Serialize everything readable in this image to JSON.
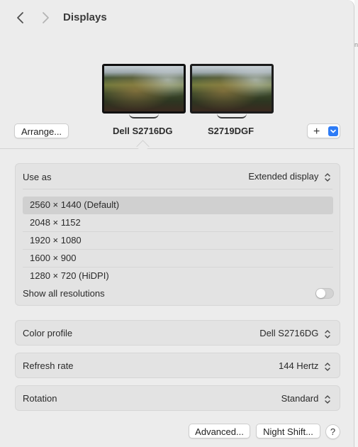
{
  "window": {
    "title": "Displays"
  },
  "displays": [
    {
      "name": "Dell S2716DG",
      "selected": true
    },
    {
      "name": "S2719DGF",
      "selected": false
    }
  ],
  "toolbar": {
    "arrange_label": "Arrange...",
    "add_label": "+"
  },
  "use_as": {
    "label": "Use as",
    "value": "Extended display"
  },
  "resolutions": [
    {
      "label": "2560 × 1440 (Default)",
      "selected": true
    },
    {
      "label": "2048 × 1152",
      "selected": false
    },
    {
      "label": "1920 × 1080",
      "selected": false
    },
    {
      "label": "1600 × 900",
      "selected": false
    },
    {
      "label": "1280 × 720 (HiDPI)",
      "selected": false
    }
  ],
  "show_all": {
    "label": "Show all resolutions",
    "enabled": false
  },
  "color_profile": {
    "label": "Color profile",
    "value": "Dell S2716DG"
  },
  "refresh_rate": {
    "label": "Refresh rate",
    "value": "144 Hertz"
  },
  "rotation": {
    "label": "Rotation",
    "value": "Standard"
  },
  "footer": {
    "advanced_label": "Advanced...",
    "night_shift_label": "Night Shift...",
    "help_label": "?"
  },
  "colors": {
    "accent": "#2e7cf6",
    "window_bg": "#ececec",
    "panel_bg": "#e3e3e3",
    "selected_row": "#d0d0d0"
  }
}
